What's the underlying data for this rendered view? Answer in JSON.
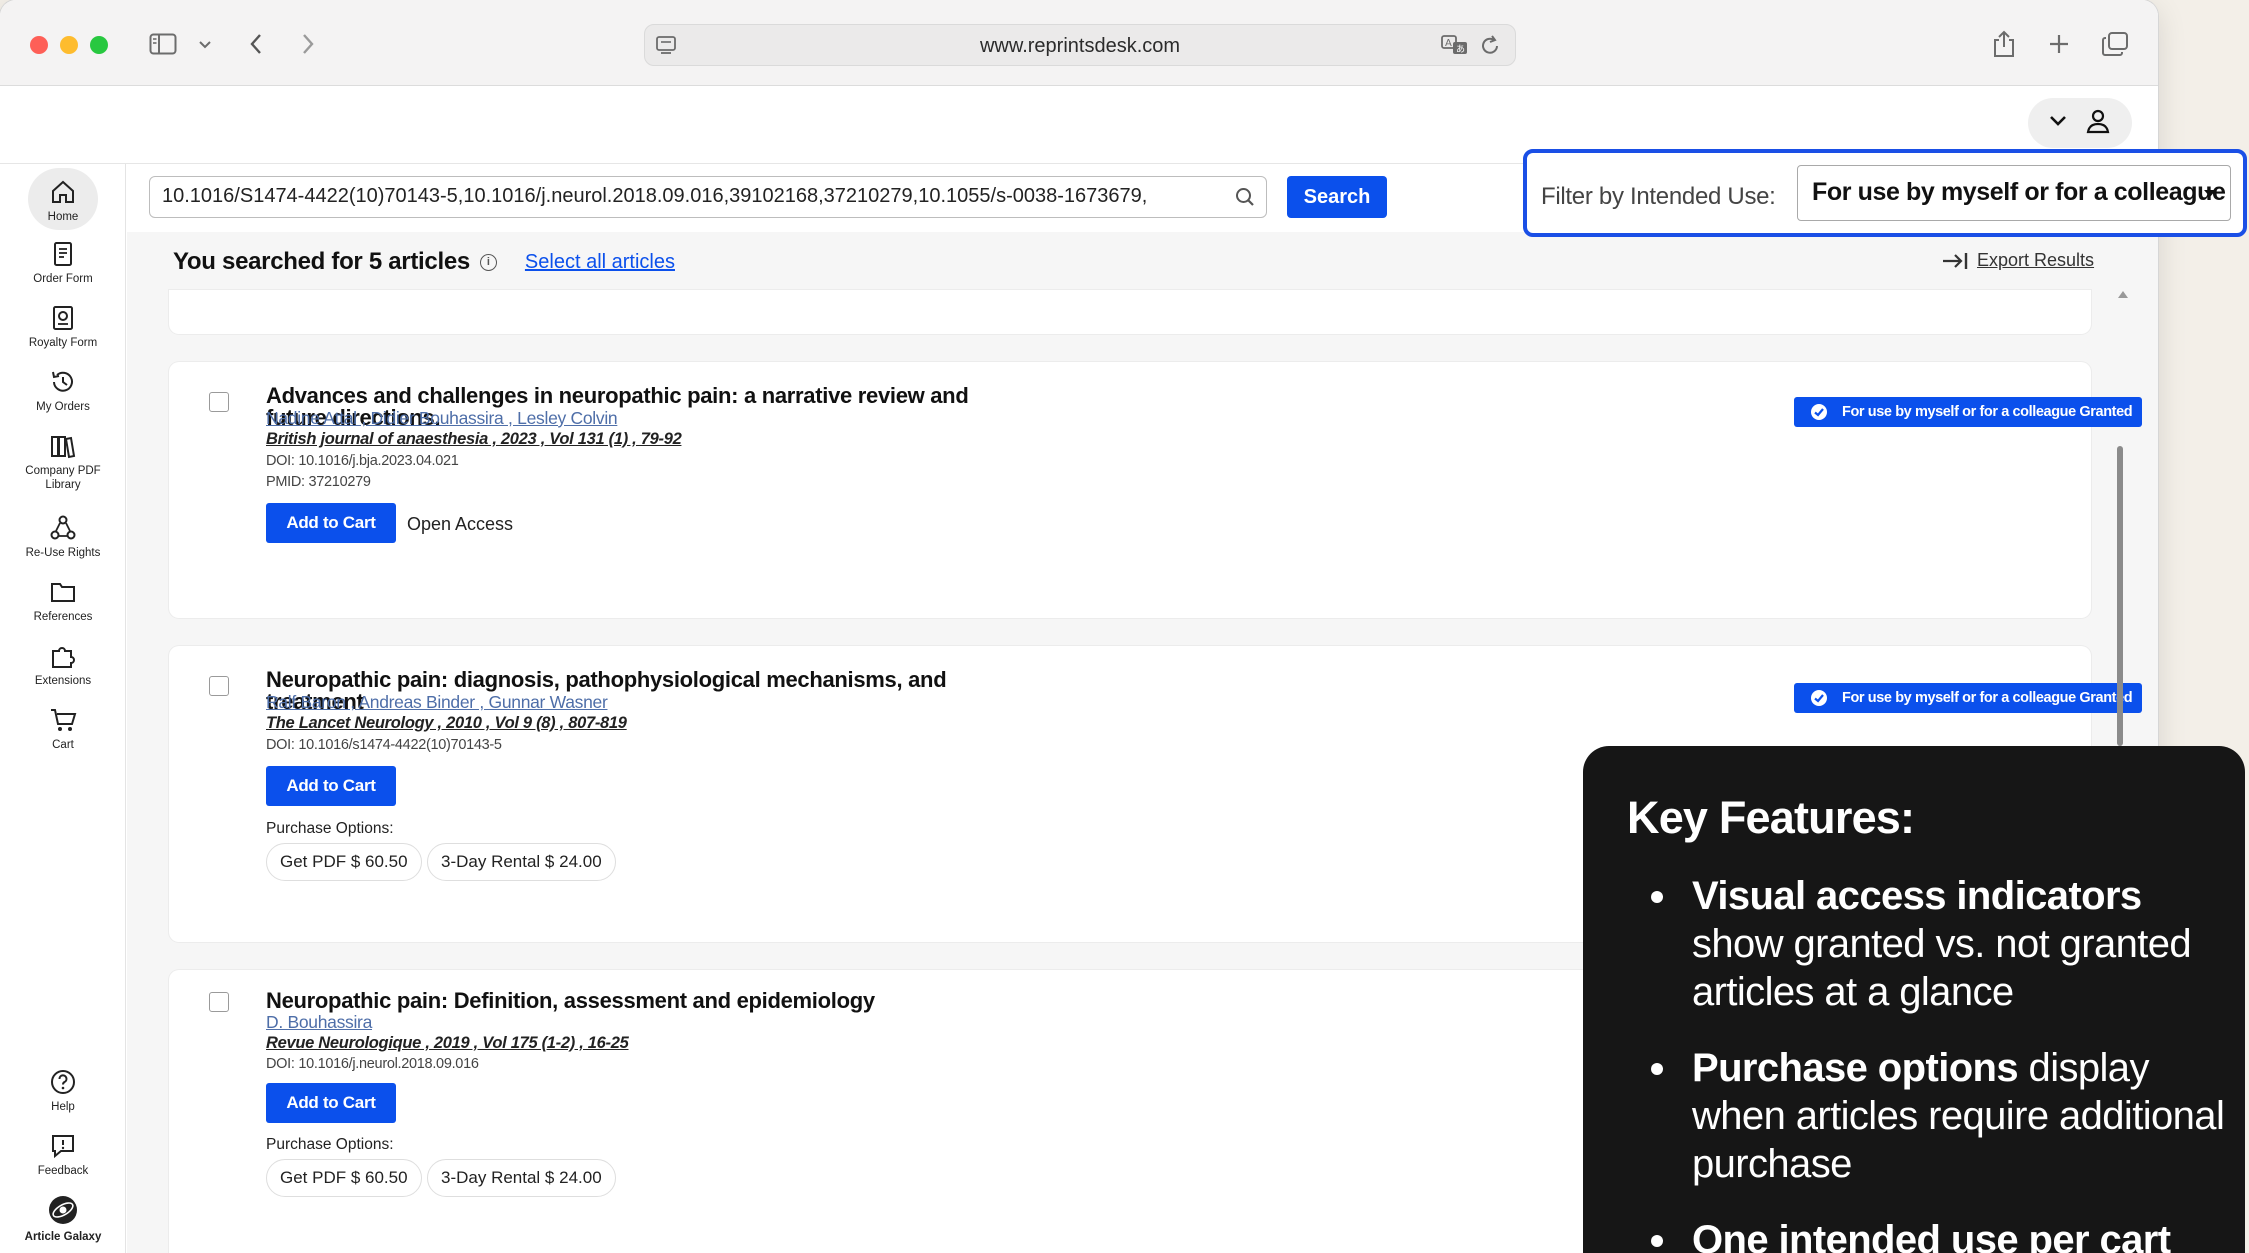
{
  "browser": {
    "url": "www.reprintsdesk.com"
  },
  "sidebar": {
    "items": [
      {
        "label": "Home"
      },
      {
        "label": "Order Form"
      },
      {
        "label": "Royalty Form"
      },
      {
        "label": "My Orders"
      },
      {
        "label": "Company PDF Library"
      },
      {
        "label": "Re-Use Rights"
      },
      {
        "label": "References"
      },
      {
        "label": "Extensions"
      },
      {
        "label": "Cart"
      }
    ],
    "bottom": [
      {
        "label": "Help"
      },
      {
        "label": "Feedback"
      },
      {
        "label": "Article Galaxy"
      }
    ]
  },
  "search": {
    "value": "10.1016/S1474-4422(10)70143-5,10.1016/j.neurol.2018.09.016,39102168,37210279,10.1055/s-0038-1673679,",
    "button": "Search"
  },
  "filter": {
    "label": "Filter by Intended Use:",
    "selected": "For use by myself or for a colleague"
  },
  "results": {
    "heading": "You searched for 5 articles",
    "select_all": "Select all articles",
    "export": "Export Results"
  },
  "articles": [
    {
      "title": "Advances and challenges in neuropathic pain: a narrative review and future directions.",
      "authors": "Nadine Attal , Didier Bouhassira , Lesley Colvin",
      "journal": "British journal of anaesthesia , 2023 , Vol 131 (1) , 79-92",
      "doi": "DOI: 10.1016/j.bja.2023.04.021",
      "pmid": "PMID: 37210279",
      "cart": "Add to Cart",
      "access": "Open Access",
      "badge": "For use by myself or for a colleague Granted"
    },
    {
      "title": "Neuropathic pain: diagnosis, pathophysiological mechanisms, and treatment",
      "authors": "Ralf Baron , Andreas Binder , Gunnar Wasner",
      "journal": "The Lancet Neurology , 2010 , Vol 9 (8) , 807-819",
      "doi": "DOI: 10.1016/s1474-4422(10)70143-5",
      "cart": "Add to Cart",
      "purchase_label": "Purchase Options:",
      "options": [
        "Get PDF $ 60.50",
        "3-Day Rental $ 24.00"
      ],
      "badge": "For use by myself or for a colleague Granted"
    },
    {
      "title": "Neuropathic pain: Definition, assessment and epidemiology",
      "authors": "D. Bouhassira",
      "journal": "Revue Neurologique , 2019 , Vol 175 (1-2) , 16-25",
      "doi": "DOI: 10.1016/j.neurol.2018.09.016",
      "cart": "Add to Cart",
      "purchase_label": "Purchase Options:",
      "options": [
        "Get PDF $ 60.50",
        "3-Day Rental $ 24.00"
      ]
    }
  ],
  "features": {
    "title": "Key Features:",
    "items": [
      {
        "bold": "Visual access indicators",
        "rest": " show granted vs. not granted articles at a glance"
      },
      {
        "bold": "Purchase options",
        "rest": " display when articles require additional purchase"
      },
      {
        "bold": "One intended use per cart",
        "rest": ""
      }
    ]
  },
  "colors": {
    "accent": "#0b50ec",
    "callout_border": "#1a4fe6",
    "panel_bg": "#161616"
  }
}
